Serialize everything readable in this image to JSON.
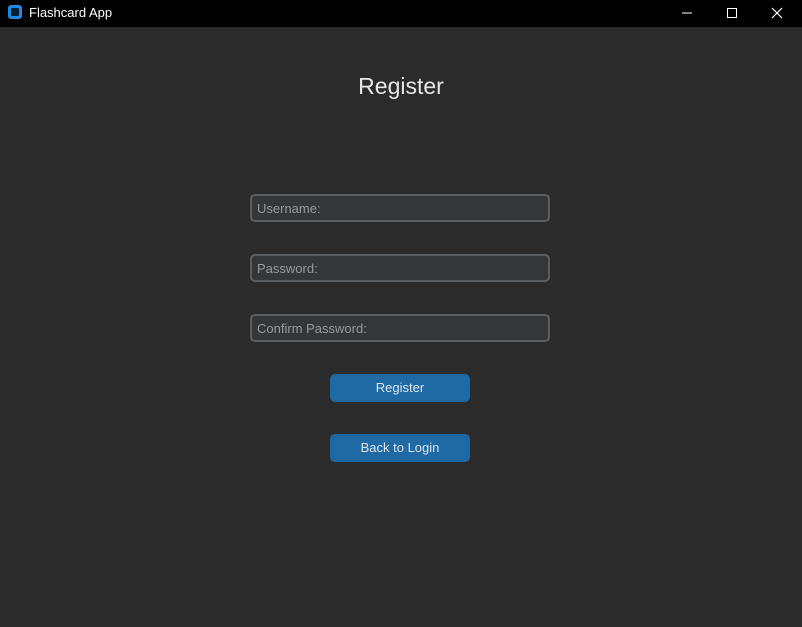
{
  "window": {
    "title": "Flashcard App",
    "accent_color": "#1f8ae6",
    "icons": {
      "app": "app-icon",
      "minimize": "minimize-icon",
      "maximize": "maximize-icon",
      "close": "close-icon"
    }
  },
  "page": {
    "title": "Register"
  },
  "form": {
    "username": {
      "placeholder": "Username:",
      "value": ""
    },
    "password": {
      "placeholder": "Password:",
      "value": ""
    },
    "confirm_password": {
      "placeholder": "Confirm Password:",
      "value": ""
    },
    "register_label": "Register",
    "back_label": "Back to Login",
    "button_color": "#1f6aa5"
  }
}
